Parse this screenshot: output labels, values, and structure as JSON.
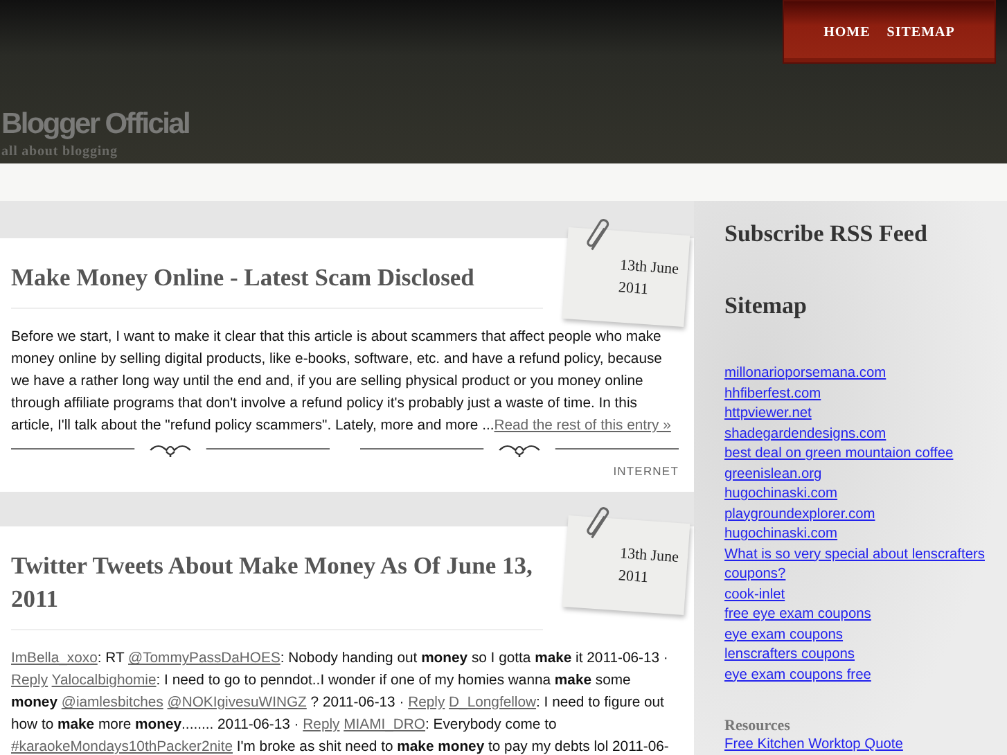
{
  "nav": [
    "HOME",
    "SITEMAP"
  ],
  "site": {
    "title": "Blogger Official",
    "tagline": "all about blogging"
  },
  "posts": [
    {
      "title": "Make Money Online - Latest Scam Disclosed",
      "date": [
        "13th June",
        "2011"
      ],
      "segments": [
        {
          "kind": "text",
          "text": "Before we start, I want to make it clear that this article is about scammers that affect people who make money online by selling digital products, like e-books, software, etc. and have a refund policy, because we have a rather long way until the end and, if you are selling physical product or you money online through affiliate programs that don't involve a refund policy it's probably just a waste of time. In this article, I'll talk about the \"refund policy scammers\". Lately, more and more ..."
        },
        {
          "kind": "link",
          "text": "Read the rest of this entry »"
        }
      ],
      "category": "INTERNET"
    },
    {
      "title": "Twitter Tweets About Make Money As Of June 13, 2011",
      "date": [
        "13th June",
        "2011"
      ],
      "segments": [
        {
          "kind": "link",
          "text": "ImBella_xoxo"
        },
        {
          "kind": "text",
          "text": ": RT "
        },
        {
          "kind": "link",
          "text": "@TommyPassDaHOES"
        },
        {
          "kind": "text",
          "text": ": Nobody handing out **money** so I gotta **make** it 2011-06-13 · "
        },
        {
          "kind": "link",
          "text": "Reply"
        },
        {
          "kind": "link",
          "text": "Yalocalbighomie"
        },
        {
          "kind": "text",
          "text": ": I need to go to penndot..I wonder if one of my homies wanna **make** some **money** "
        },
        {
          "kind": "link",
          "text": "@iamlesbitches"
        },
        {
          "kind": "link",
          "text": "@NOKIgivesuWINGZ"
        },
        {
          "kind": "text",
          "text": " ? 2011-06-13 · "
        },
        {
          "kind": "link",
          "text": "Reply"
        },
        {
          "kind": "link",
          "text": "D_Longfellow"
        },
        {
          "kind": "text",
          "text": ": I need to figure out how to **make** more **money**........ 2011-06-13 · "
        },
        {
          "kind": "link",
          "text": "Reply"
        },
        {
          "kind": "link",
          "text": "MIAMI_DRO"
        },
        {
          "kind": "text",
          "text": ": Everybody come to "
        },
        {
          "kind": "link",
          "text": "#karaokeMondays10thPacker2nite"
        },
        {
          "kind": "text",
          "text": " I'm broke as shit need to **make money** to pay my debts lol 2011-06-"
        }
      ]
    }
  ],
  "sidebar": {
    "rss_heading": "Subscribe RSS Feed",
    "sitemap_heading": "Sitemap",
    "sitemap_links": [
      "millonarioporsemana.com",
      "hhfiberfest.com",
      "httpviewer.net",
      "shadegardendesigns.com",
      "best deal on green mountaion coffee",
      "greenislean.org",
      "hugochinaski.com",
      "playgroundexplorer.com",
      "hugochinaski.com",
      "What is so very special about lenscrafters coupons?",
      "cook-inlet",
      "free eye exam coupons",
      "eye exam coupons",
      "lenscrafters coupons",
      "eye exam coupons free"
    ],
    "resources_heading": "Resources",
    "resources_links": [
      "Free Kitchen Worktop Quote"
    ]
  }
}
